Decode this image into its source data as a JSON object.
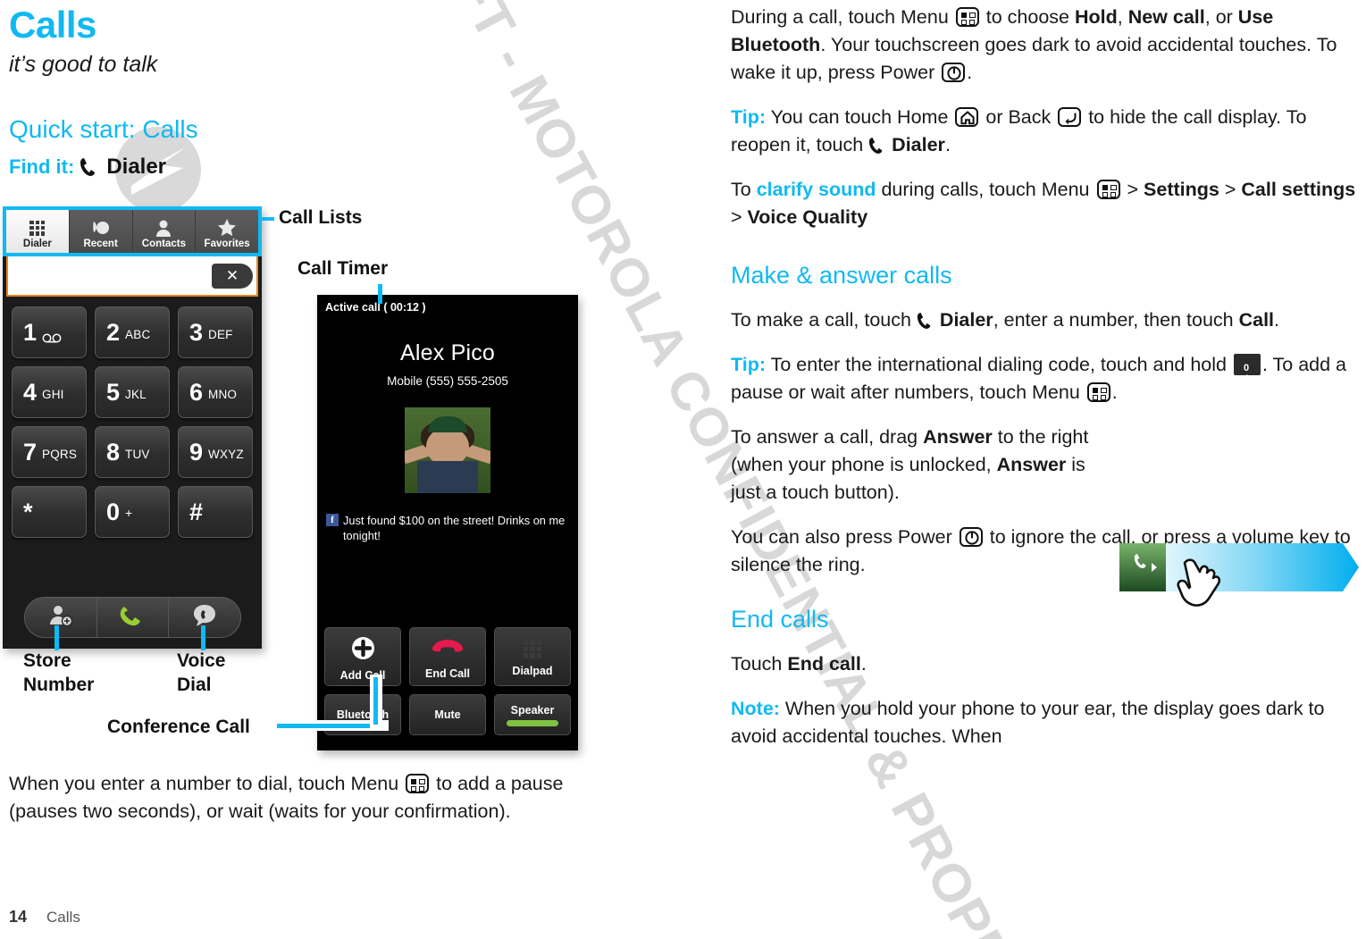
{
  "page": {
    "title": "Calls",
    "subtitle": "it’s good to talk",
    "footer_number": "14",
    "footer_label": "Calls",
    "watermark": "DRAFT - MOTOROLA CONFIDENTIAL & PROPRIETARY INFORMATION",
    "accent_color": "#10B9F1"
  },
  "left": {
    "quick_start_heading": "Quick start: Calls",
    "find_it_label": "Find it:",
    "find_it_app": "Dialer",
    "closing_paragraph_1": "When you enter a number to dial, touch Menu ",
    "closing_paragraph_2": " to add a pause (pauses two seconds), or wait (waits for your confirmation)."
  },
  "callouts": {
    "call_lists": "Call Lists",
    "call_timer": "Call Timer",
    "store_number_line1": "Store",
    "store_number_line2": "Number",
    "voice_dial_line1": "Voice",
    "voice_dial_line2": "Dial",
    "conference_call": "Conference Call"
  },
  "dialer": {
    "tabs": [
      {
        "label": "Dialer",
        "icon": "dialpad-grid-icon",
        "active": true
      },
      {
        "label": "Recent",
        "icon": "recent-calls-icon",
        "active": false
      },
      {
        "label": "Contacts",
        "icon": "contact-person-icon",
        "active": false
      },
      {
        "label": "Favorites",
        "icon": "star-icon",
        "active": false
      }
    ],
    "number_field_value": "",
    "backspace_icon": "close-x-icon",
    "keys": [
      [
        {
          "digit": "1",
          "letters": "",
          "icon": "voicemail-icon"
        },
        {
          "digit": "2",
          "letters": "ABC",
          "icon": ""
        },
        {
          "digit": "3",
          "letters": "DEF",
          "icon": ""
        }
      ],
      [
        {
          "digit": "4",
          "letters": "GHI",
          "icon": ""
        },
        {
          "digit": "5",
          "letters": "JKL",
          "icon": ""
        },
        {
          "digit": "6",
          "letters": "MNO",
          "icon": ""
        }
      ],
      [
        {
          "digit": "7",
          "letters": "PQRS",
          "icon": ""
        },
        {
          "digit": "8",
          "letters": "TUV",
          "icon": ""
        },
        {
          "digit": "9",
          "letters": "WXYZ",
          "icon": ""
        }
      ],
      [
        {
          "digit": "*",
          "letters": "",
          "icon": ""
        },
        {
          "digit": "0",
          "letters": "+",
          "icon": ""
        },
        {
          "digit": "#",
          "letters": "",
          "icon": ""
        }
      ]
    ],
    "actions": [
      {
        "name": "store-number",
        "icon": "add-contact-icon"
      },
      {
        "name": "call",
        "icon": "green-handset-icon"
      },
      {
        "name": "voice-dial",
        "icon": "voice-dial-icon"
      }
    ]
  },
  "active_call": {
    "status": "Active call ( 00:12 )",
    "contact_name": "Alex Pico",
    "contact_number": "Mobile (555) 555-2505",
    "social_icon": "facebook-icon",
    "social_status": "Just found $100 on the street! Drinks on me tonight!",
    "buttons_row1": [
      {
        "label": "Add Call",
        "icon": "plus-circle-icon"
      },
      {
        "label": "End Call",
        "icon": "end-call-handset-icon"
      },
      {
        "label": "Dialpad",
        "icon": "dialpad-grid-icon"
      }
    ],
    "buttons_row2": [
      {
        "label": "Bluetooth",
        "icon": "",
        "on": false
      },
      {
        "label": "Mute",
        "icon": "",
        "on": false
      },
      {
        "label": "Speaker",
        "icon": "",
        "on": true
      }
    ]
  },
  "right": {
    "p1_a": "During a call, touch Menu ",
    "p1_b": " to choose ",
    "p1_hold": "Hold",
    "p1_c": ", ",
    "p1_newcall": "New call",
    "p1_d": ", or ",
    "p1_bt": "Use Bluetooth",
    "p1_e": ". Your touchscreen goes dark to avoid accidental touches. To wake it up, press Power ",
    "p1_f": ".",
    "p2_lead": "Tip:",
    "p2_a": " You can touch Home ",
    "p2_b": " or Back ",
    "p2_c": " to hide the call display. To reopen it, touch ",
    "p2_dialer": "Dialer",
    "p2_d": ".",
    "p3_a": "To ",
    "p3_kw": "clarify sound",
    "p3_b": " during calls, touch Menu ",
    "p3_c": " > ",
    "p3_settings": "Settings",
    "p3_d": " > ",
    "p3_callsettings": "Call settings",
    "p3_e": " > ",
    "p3_voicequality": "Voice Quality",
    "h_make": "Make & answer calls",
    "p4_a": "To make a call, touch ",
    "p4_dialer": "Dialer",
    "p4_b": ", enter a number, then touch ",
    "p4_call": "Call",
    "p4_c": ".",
    "p5_lead": "Tip:",
    "p5_a": " To enter the international dialing code, touch and hold ",
    "p5_b": ". To add a pause or wait after numbers, touch Menu ",
    "p5_c": ".",
    "p6_a": "To answer a call, drag ",
    "p6_answer": "Answer",
    "p6_b": " to the right (when your phone is unlocked, ",
    "p6_answer2": "Answer",
    "p6_c": " is just a touch button).",
    "p7_a": "You can also press Power ",
    "p7_b": " to ignore the call, or press a volume key to silence the ring.",
    "h_end": "End calls",
    "p8_a": "Touch ",
    "p8_endcall": "End call",
    "p8_b": ".",
    "p9_lead": "Note:",
    "p9_a": " When you hold your phone to your ear, the display goes dark to avoid accidental touches. When"
  }
}
